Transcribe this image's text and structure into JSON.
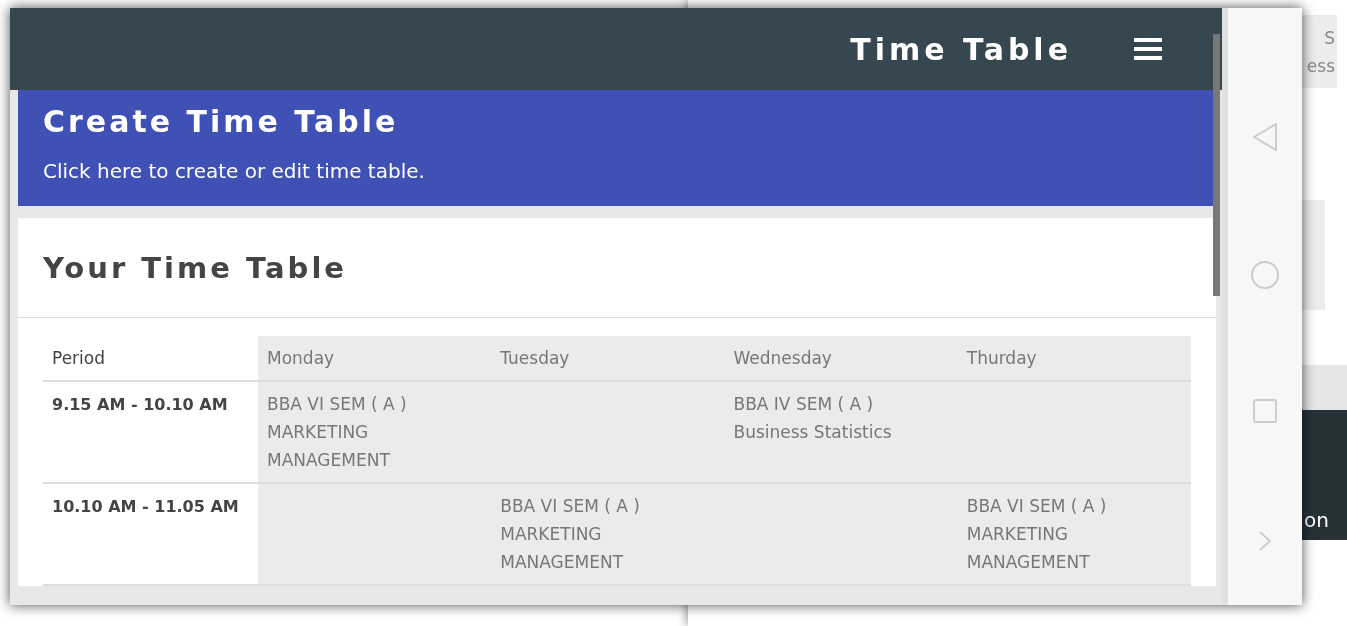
{
  "background_screen": {
    "fragments": [
      "S",
      "ess",
      "on"
    ]
  },
  "app_bar": {
    "title": "Time Table"
  },
  "create_card": {
    "title": "Create Time Table",
    "text": "Click here to create or edit time table."
  },
  "timetable": {
    "title": "Your Time Table",
    "columns": [
      "Period",
      "Monday",
      "Tuesday",
      "Wednesday",
      "Thurday"
    ],
    "rows": [
      {
        "cells": [
          [
            "9.15 AM - 10.10 AM"
          ],
          [
            "BBA VI SEM ( A )",
            "MARKETING MANAGEMENT"
          ],
          [],
          [
            "BBA IV SEM ( A )",
            "Business Statistics"
          ],
          []
        ]
      },
      {
        "cells": [
          [
            "10.10 AM - 11.05 AM"
          ],
          [],
          [
            "BBA VI SEM ( A )",
            "MARKETING MANAGEMENT"
          ],
          [],
          [
            "BBA VI SEM ( A )",
            "MARKETING MANAGEMENT"
          ]
        ]
      }
    ]
  }
}
